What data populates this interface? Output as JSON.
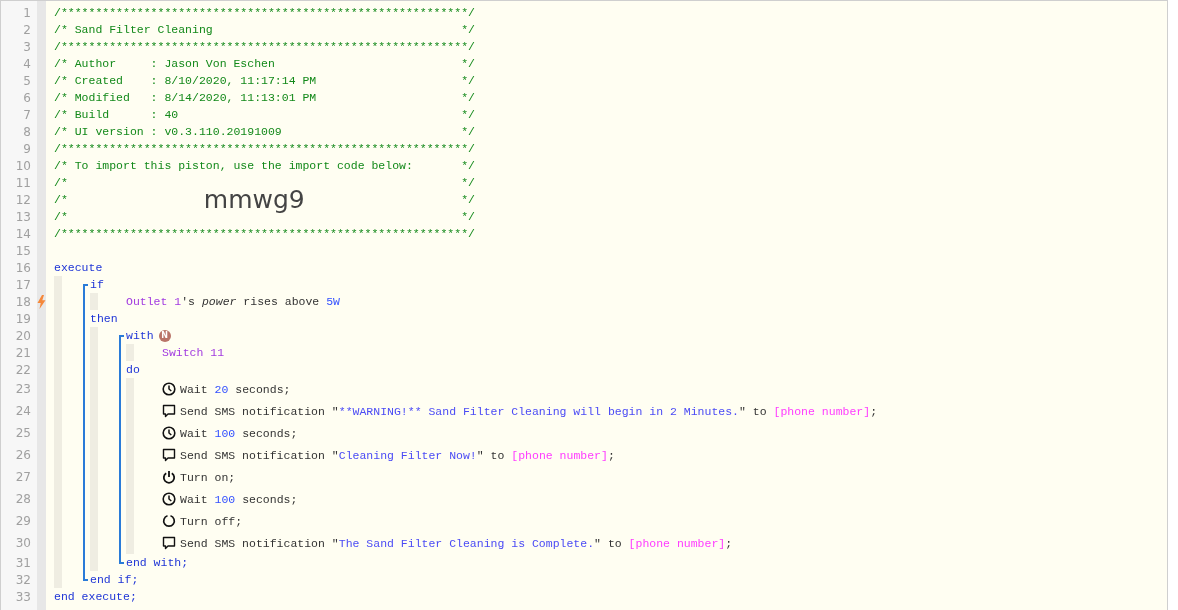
{
  "header": [
    {
      "number": "1",
      "text": "/***********************************************************/"
    },
    {
      "number": "2",
      "text": "/* Sand Filter Cleaning",
      "close": "*/"
    },
    {
      "number": "3",
      "text": "/***********************************************************/"
    },
    {
      "number": "4",
      "text": "/* Author     : Jason Von Eschen",
      "close": "*/"
    },
    {
      "number": "5",
      "text": "/* Created    : 8/10/2020, 11:17:14 PM",
      "close": "*/"
    },
    {
      "number": "6",
      "text": "/* Modified   : 8/14/2020, 11:13:01 PM",
      "close": "*/"
    },
    {
      "number": "7",
      "text": "/* Build      : 40",
      "close": "*/"
    },
    {
      "number": "8",
      "text": "/* UI version : v0.3.110.20191009",
      "close": "*/"
    },
    {
      "number": "9",
      "text": "/***********************************************************/"
    },
    {
      "number": "10",
      "text": "/* To import this piston, use the import code below:",
      "close": "*/"
    },
    {
      "number": "11",
      "text": "/*",
      "close": "*/"
    },
    {
      "number": "12",
      "text": "/*",
      "code": "mmwg9",
      "close": "*/"
    },
    {
      "number": "13",
      "text": "/*",
      "close": "*/"
    },
    {
      "number": "14",
      "text": "/***********************************************************/"
    },
    {
      "number": "15"
    }
  ],
  "code": [
    {
      "number": "16",
      "tokens": [
        {
          "kind": "keyword",
          "text": "execute"
        }
      ],
      "children": [
        {
          "kind": "block",
          "children": [
            {
              "number": "17",
              "tokens": [
                {
                  "kind": "keyword",
                  "text": "if"
                }
              ],
              "children": [
                {
                  "number": "18",
                  "trigger": true,
                  "tokens": [
                    {
                      "kind": "device",
                      "text": "Outlet 1"
                    },
                    {
                      "kind": "text",
                      "text": "'s "
                    },
                    {
                      "kind": "attribute",
                      "text": "power"
                    },
                    {
                      "kind": "text",
                      "text": " rises above "
                    },
                    {
                      "kind": "number",
                      "text": "5W"
                    }
                  ]
                }
              ]
            },
            {
              "number": "19",
              "tokens": [
                {
                  "kind": "keyword",
                  "text": "then"
                }
              ],
              "children": [
                {
                  "kind": "block",
                  "children": [
                    {
                      "number": "20",
                      "badge": "N",
                      "tokens": [
                        {
                          "kind": "keyword",
                          "text": "with"
                        }
                      ],
                      "children": [
                        {
                          "number": "21",
                          "tokens": [
                            {
                              "kind": "device",
                              "text": "Switch 11"
                            }
                          ]
                        }
                      ]
                    },
                    {
                      "number": "22",
                      "tokens": [
                        {
                          "kind": "keyword",
                          "text": "do"
                        }
                      ],
                      "children": [
                        {
                          "number": "23",
                          "kind": "wait",
                          "tokens": [
                            {
                              "kind": "text",
                              "text": "Wait "
                            },
                            {
                              "kind": "number",
                              "text": "20"
                            },
                            {
                              "kind": "text",
                              "text": " seconds;"
                            }
                          ]
                        },
                        {
                          "number": "24",
                          "kind": "sms",
                          "tokens": [
                            {
                              "kind": "text",
                              "text": "Send SMS notification \""
                            },
                            {
                              "kind": "string",
                              "text": "**WARNING!** Sand Filter Cleaning will begin in 2 Minutes."
                            },
                            {
                              "kind": "text",
                              "text": "\" to "
                            },
                            {
                              "kind": "variable",
                              "text": "[phone number]"
                            },
                            {
                              "kind": "text",
                              "text": ";"
                            }
                          ]
                        },
                        {
                          "number": "25",
                          "kind": "wait",
                          "tokens": [
                            {
                              "kind": "text",
                              "text": "Wait "
                            },
                            {
                              "kind": "number",
                              "text": "100"
                            },
                            {
                              "kind": "text",
                              "text": " seconds;"
                            }
                          ]
                        },
                        {
                          "number": "26",
                          "kind": "sms",
                          "tokens": [
                            {
                              "kind": "text",
                              "text": "Send SMS notification \""
                            },
                            {
                              "kind": "string",
                              "text": "Cleaning Filter Now!"
                            },
                            {
                              "kind": "text",
                              "text": "\" to "
                            },
                            {
                              "kind": "variable",
                              "text": "[phone number]"
                            },
                            {
                              "kind": "text",
                              "text": ";"
                            }
                          ]
                        },
                        {
                          "number": "27",
                          "kind": "on",
                          "tokens": [
                            {
                              "kind": "text",
                              "text": "Turn on;"
                            }
                          ]
                        },
                        {
                          "number": "28",
                          "kind": "wait",
                          "tokens": [
                            {
                              "kind": "text",
                              "text": "Wait "
                            },
                            {
                              "kind": "number",
                              "text": "100"
                            },
                            {
                              "kind": "text",
                              "text": " seconds;"
                            }
                          ]
                        },
                        {
                          "number": "29",
                          "kind": "off",
                          "tokens": [
                            {
                              "kind": "text",
                              "text": "Turn off;"
                            }
                          ]
                        },
                        {
                          "number": "30",
                          "kind": "sms",
                          "tokens": [
                            {
                              "kind": "text",
                              "text": "Send SMS notification \""
                            },
                            {
                              "kind": "string",
                              "text": "The Sand Filter Cleaning is Complete."
                            },
                            {
                              "kind": "text",
                              "text": "\" to "
                            },
                            {
                              "kind": "variable",
                              "text": "[phone number]"
                            },
                            {
                              "kind": "text",
                              "text": ";"
                            }
                          ]
                        }
                      ]
                    },
                    {
                      "number": "31",
                      "tokens": [
                        {
                          "kind": "keyword",
                          "text": "end with;"
                        }
                      ]
                    }
                  ]
                }
              ]
            },
            {
              "number": "32",
              "tokens": [
                {
                  "kind": "keyword",
                  "text": "end if;"
                }
              ]
            }
          ]
        }
      ]
    },
    {
      "number": "33",
      "tokens": [
        {
          "kind": "keyword",
          "text": "end execute;"
        }
      ]
    }
  ]
}
